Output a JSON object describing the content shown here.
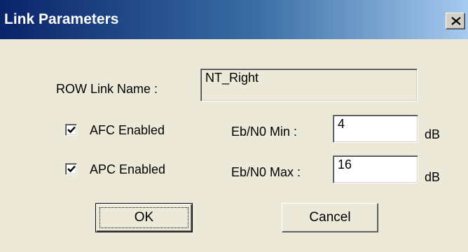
{
  "window": {
    "title": "Link Parameters",
    "close_icon": "close-icon"
  },
  "form": {
    "row_link_name_label": "ROW Link Name :",
    "row_link_name_value": "NT_Right",
    "afc": {
      "label": "AFC Enabled",
      "checked": true
    },
    "apc": {
      "label": "APC Enabled",
      "checked": true
    },
    "ebno_min": {
      "label": "Eb/N0 Min :",
      "value": "4",
      "unit": "dB"
    },
    "ebno_max": {
      "label": "Eb/N0 Max :",
      "value": "16",
      "unit": "dB"
    }
  },
  "buttons": {
    "ok_label": "OK",
    "cancel_label": "Cancel"
  }
}
